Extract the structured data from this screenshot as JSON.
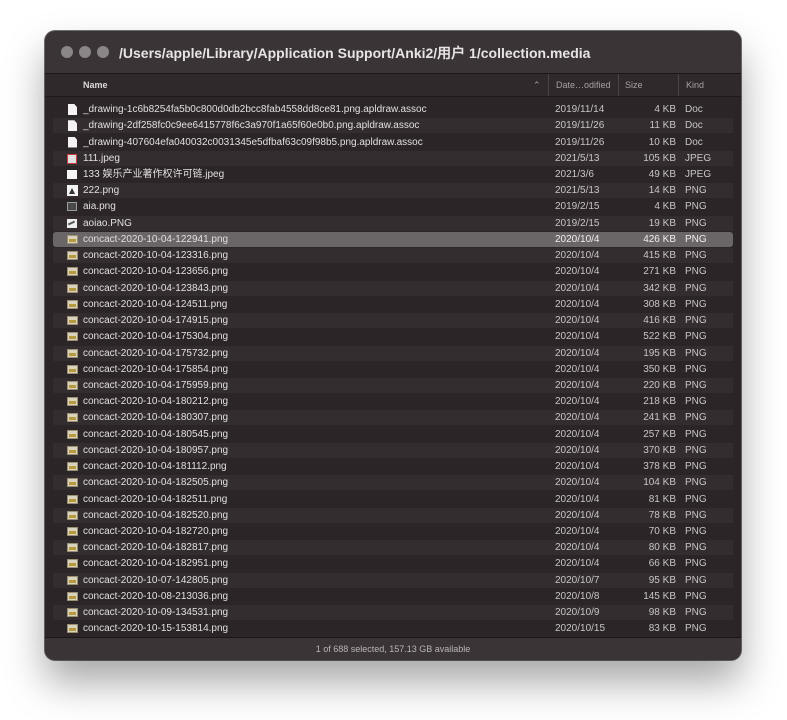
{
  "window": {
    "title": "/Users/apple/Library/Application Support/Anki2/用户 1/collection.media",
    "status": "1 of 688 selected, 157.13 GB available"
  },
  "columns": {
    "name": "Name",
    "date": "Date…odified",
    "size": "Size",
    "kind": "Kind"
  },
  "rows": [
    {
      "name": "_drawing-1c6b8254fa5b0c800d0db2bcc8fab4558dd8ce81.png.apldraw.assoc",
      "date": "2019/11/14",
      "size": "4 KB",
      "kind": "Doc",
      "icon": "doc"
    },
    {
      "name": "_drawing-2df258fc0c9ee6415778f6c3a970f1a65f60e0b0.png.apldraw.assoc",
      "date": "2019/11/26",
      "size": "11 KB",
      "kind": "Doc",
      "icon": "doc"
    },
    {
      "name": "_drawing-407604efa040032c0031345e5dfbaf63c09f98b5.png.apldraw.assoc",
      "date": "2019/11/26",
      "size": "10 KB",
      "kind": "Doc",
      "icon": "doc"
    },
    {
      "name": "111.jpeg",
      "date": "2021/5/13",
      "size": "105 KB",
      "kind": "JPEG",
      "icon": "jpg1"
    },
    {
      "name": "133 娱乐产业著作权许可链.jpeg",
      "date": "2021/3/6",
      "size": "49 KB",
      "kind": "JPEG",
      "icon": "jpg2"
    },
    {
      "name": "222.png",
      "date": "2021/5/13",
      "size": "14 KB",
      "kind": "PNG",
      "icon": "dark1"
    },
    {
      "name": "aia.png",
      "date": "2019/2/15",
      "size": "4 KB",
      "kind": "PNG",
      "icon": "dark2"
    },
    {
      "name": "aoiao.PNG",
      "date": "2019/2/15",
      "size": "19 KB",
      "kind": "PNG",
      "icon": "dark3"
    },
    {
      "name": "concact-2020-10-04-122941.png",
      "date": "2020/10/4",
      "size": "426 KB",
      "kind": "PNG",
      "icon": "img",
      "selected": true
    },
    {
      "name": "concact-2020-10-04-123316.png",
      "date": "2020/10/4",
      "size": "415 KB",
      "kind": "PNG",
      "icon": "img"
    },
    {
      "name": "concact-2020-10-04-123656.png",
      "date": "2020/10/4",
      "size": "271 KB",
      "kind": "PNG",
      "icon": "img"
    },
    {
      "name": "concact-2020-10-04-123843.png",
      "date": "2020/10/4",
      "size": "342 KB",
      "kind": "PNG",
      "icon": "img"
    },
    {
      "name": "concact-2020-10-04-124511.png",
      "date": "2020/10/4",
      "size": "308 KB",
      "kind": "PNG",
      "icon": "img"
    },
    {
      "name": "concact-2020-10-04-174915.png",
      "date": "2020/10/4",
      "size": "416 KB",
      "kind": "PNG",
      "icon": "img"
    },
    {
      "name": "concact-2020-10-04-175304.png",
      "date": "2020/10/4",
      "size": "522 KB",
      "kind": "PNG",
      "icon": "img"
    },
    {
      "name": "concact-2020-10-04-175732.png",
      "date": "2020/10/4",
      "size": "195 KB",
      "kind": "PNG",
      "icon": "img"
    },
    {
      "name": "concact-2020-10-04-175854.png",
      "date": "2020/10/4",
      "size": "350 KB",
      "kind": "PNG",
      "icon": "img"
    },
    {
      "name": "concact-2020-10-04-175959.png",
      "date": "2020/10/4",
      "size": "220 KB",
      "kind": "PNG",
      "icon": "img"
    },
    {
      "name": "concact-2020-10-04-180212.png",
      "date": "2020/10/4",
      "size": "218 KB",
      "kind": "PNG",
      "icon": "img"
    },
    {
      "name": "concact-2020-10-04-180307.png",
      "date": "2020/10/4",
      "size": "241 KB",
      "kind": "PNG",
      "icon": "img"
    },
    {
      "name": "concact-2020-10-04-180545.png",
      "date": "2020/10/4",
      "size": "257 KB",
      "kind": "PNG",
      "icon": "img"
    },
    {
      "name": "concact-2020-10-04-180957.png",
      "date": "2020/10/4",
      "size": "370 KB",
      "kind": "PNG",
      "icon": "img"
    },
    {
      "name": "concact-2020-10-04-181112.png",
      "date": "2020/10/4",
      "size": "378 KB",
      "kind": "PNG",
      "icon": "img"
    },
    {
      "name": "concact-2020-10-04-182505.png",
      "date": "2020/10/4",
      "size": "104 KB",
      "kind": "PNG",
      "icon": "img"
    },
    {
      "name": "concact-2020-10-04-182511.png",
      "date": "2020/10/4",
      "size": "81 KB",
      "kind": "PNG",
      "icon": "img"
    },
    {
      "name": "concact-2020-10-04-182520.png",
      "date": "2020/10/4",
      "size": "78 KB",
      "kind": "PNG",
      "icon": "img"
    },
    {
      "name": "concact-2020-10-04-182720.png",
      "date": "2020/10/4",
      "size": "70 KB",
      "kind": "PNG",
      "icon": "img"
    },
    {
      "name": "concact-2020-10-04-182817.png",
      "date": "2020/10/4",
      "size": "80 KB",
      "kind": "PNG",
      "icon": "img"
    },
    {
      "name": "concact-2020-10-04-182951.png",
      "date": "2020/10/4",
      "size": "66 KB",
      "kind": "PNG",
      "icon": "img"
    },
    {
      "name": "concact-2020-10-07-142805.png",
      "date": "2020/10/7",
      "size": "95 KB",
      "kind": "PNG",
      "icon": "img"
    },
    {
      "name": "concact-2020-10-08-213036.png",
      "date": "2020/10/8",
      "size": "145 KB",
      "kind": "PNG",
      "icon": "img"
    },
    {
      "name": "concact-2020-10-09-134531.png",
      "date": "2020/10/9",
      "size": "98 KB",
      "kind": "PNG",
      "icon": "img"
    },
    {
      "name": "concact-2020-10-15-153814.png",
      "date": "2020/10/15",
      "size": "83 KB",
      "kind": "PNG",
      "icon": "img"
    }
  ]
}
